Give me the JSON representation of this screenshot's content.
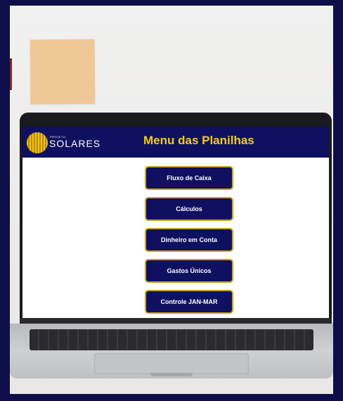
{
  "header": {
    "logo_small": "PROJETO",
    "logo_text": "SOLARES",
    "title": "Menu das Planilhas"
  },
  "menu": {
    "items": [
      {
        "label": "Fluxo de Caixa"
      },
      {
        "label": "Cálculos"
      },
      {
        "label": "Dinheiro em Conta"
      },
      {
        "label": "Gastos Únicos"
      },
      {
        "label": "Controle JAN-MAR"
      }
    ]
  },
  "colors": {
    "navy": "#0f1060",
    "gold": "#f4cd1a",
    "border_gold": "#c9a21c",
    "background": "#0d0d4a"
  }
}
